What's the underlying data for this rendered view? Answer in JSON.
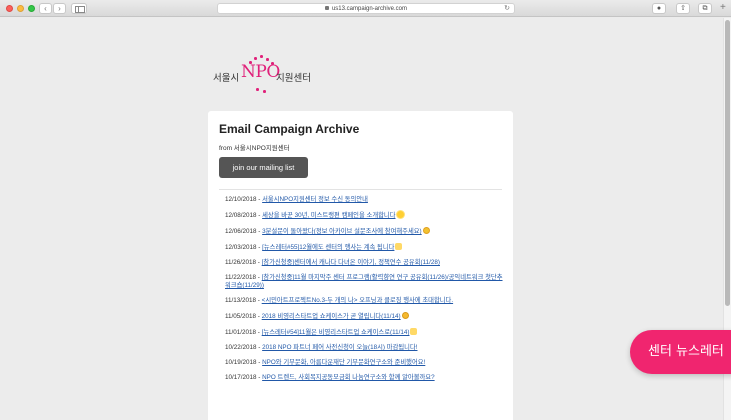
{
  "browser": {
    "url": "us13.campaign-archive.com",
    "back_icon": "chevron-left-icon",
    "forward_icon": "chevron-right-icon",
    "reload_icon": "reload-icon",
    "back_glyph": "‹",
    "forward_glyph": "›",
    "reload_glyph": "↻",
    "ext_glyph": "●",
    "share_glyph": "⇧",
    "tabs_glyph": "⧉",
    "newtab_glyph": "+"
  },
  "logo": {
    "left_text": "서울시",
    "npo_text": "NPO",
    "right_text": "지원센터",
    "brand_color": "#e0217a"
  },
  "card": {
    "title": "Email Campaign Archive",
    "from": "from 서울시NPO지원센터",
    "join_button": "join our mailing list"
  },
  "archive": [
    {
      "date": "12/10/2018",
      "title": "서울시NPO지원센터 정보 수신 동의안내",
      "emoji": ""
    },
    {
      "date": "12/08/2018",
      "title": "세상을 바꾼 30년, 미스트랭편 캠페인을 소개합니다",
      "emoji": "sun"
    },
    {
      "date": "12/06/2018",
      "title": "3분설문이 돌아왔다(정보 아카이브 설문조사에 참여해주세요)",
      "emoji": "heart-eyes"
    },
    {
      "date": "12/03/2018",
      "title": "[뉴스레터#55]12월에도 센터의 행사는 계속 됩니다",
      "emoji": "hands"
    },
    {
      "date": "11/26/2018",
      "title": "[참가신청중]센터에서 캐나다 다녀온 이야기, 정책연수 공유회(11/28)",
      "emoji": ""
    },
    {
      "date": "11/22/2018",
      "title": "[참가신청중]11월 마지막주 센터 프로그램(활력향연 연구 공유회(11/26)/공익네트워크 첫단추워크숍(11/29))",
      "emoji": ""
    },
    {
      "date": "11/13/2018",
      "title": "<시민아트프로젝트No.3-두 개의 나> 오프닝과 클로징 행사에 초대합니다.",
      "emoji": ""
    },
    {
      "date": "11/05/2018",
      "title": "2018 비영리스타트업 쇼케이스가 곧 열립니다(11/14)",
      "emoji": "smile"
    },
    {
      "date": "11/01/2018",
      "title": "[뉴스레터#54]11월은 비영리스타트업 쇼케이스로(11/14)",
      "emoji": "hands"
    },
    {
      "date": "10/22/2018",
      "title": "2018 NPO 파트너 페어 사전신청이 오늘(18시) 마감됩니다!",
      "emoji": ""
    },
    {
      "date": "10/19/2018",
      "title": "NPO와 기부문화, 아름다운재단 기부문화연구소와 준비했어요!",
      "emoji": ""
    },
    {
      "date": "10/17/2018",
      "title": "NPO 트렌드, 사회복지공동모금회 나눔연구소와 함께 알아볼까요?",
      "emoji": ""
    }
  ],
  "floating_button": {
    "label": "센터 뉴스레터",
    "color": "#f0256f"
  }
}
